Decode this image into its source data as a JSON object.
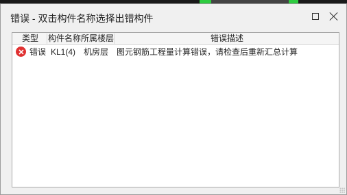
{
  "window": {
    "title": "错误 - 双击构件名称选择出错构件"
  },
  "table": {
    "columns": [
      "类型",
      "构件名称",
      "所属楼层",
      "错误描述"
    ],
    "rows": [
      {
        "icon": "error-icon",
        "type": "错误",
        "component": "KL1(4)",
        "floor": "机房层",
        "description": "图元钢筋工程量计算错误，请检查后重新汇总计算"
      }
    ]
  },
  "colors": {
    "background": "#f0f0f0",
    "panel": "#ffffff",
    "error": "#e03131"
  }
}
